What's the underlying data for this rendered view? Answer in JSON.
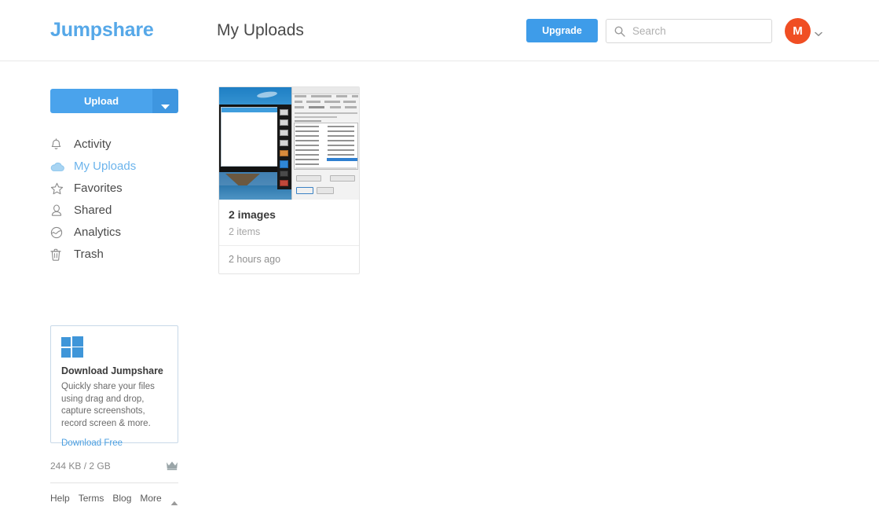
{
  "header": {
    "brand": "Jumpshare",
    "page_title": "My Uploads",
    "upgrade_label": "Upgrade",
    "search": {
      "placeholder": "Search",
      "value": "",
      "icon": "search-icon"
    },
    "avatar": {
      "initial": "M",
      "color": "#f04e23",
      "caret_icon": "chevron-down-icon"
    }
  },
  "sidebar": {
    "upload": {
      "label": "Upload",
      "color": "#4aa3ec",
      "caret_icon": "caret-down-icon"
    },
    "items": [
      {
        "label": "Activity",
        "icon": "bell-icon",
        "active": false
      },
      {
        "label": "My Uploads",
        "icon": "cloud-icon",
        "active": true
      },
      {
        "label": "Favorites",
        "icon": "star-icon",
        "active": false
      },
      {
        "label": "Shared",
        "icon": "person-icon",
        "active": false
      },
      {
        "label": "Analytics",
        "icon": "analytics-icon",
        "active": false
      },
      {
        "label": "Trash",
        "icon": "trash-icon",
        "active": false
      }
    ],
    "active_color": "#6cb4ec",
    "promo": {
      "icon": "windows-logo-icon",
      "title": "Download Jumpshare",
      "description": "Quickly share your files using drag and drop, capture screenshots, record screen & more.",
      "link_label": "Download Free",
      "link_color": "#4a9ee0"
    },
    "storage": {
      "text": "244 KB / 2 GB",
      "used": "244 KB",
      "total": "2 GB",
      "icon": "crown-icon"
    },
    "footer_links": [
      {
        "label": "Help"
      },
      {
        "label": "Terms"
      },
      {
        "label": "Blog"
      },
      {
        "label": "More"
      }
    ],
    "footer_caret_icon": "caret-up-icon"
  },
  "main": {
    "cards": [
      {
        "title": "2 images",
        "items_count": "2 items",
        "time": "2 hours ago",
        "thumbnail": "screenshot-pair-preview"
      }
    ]
  }
}
